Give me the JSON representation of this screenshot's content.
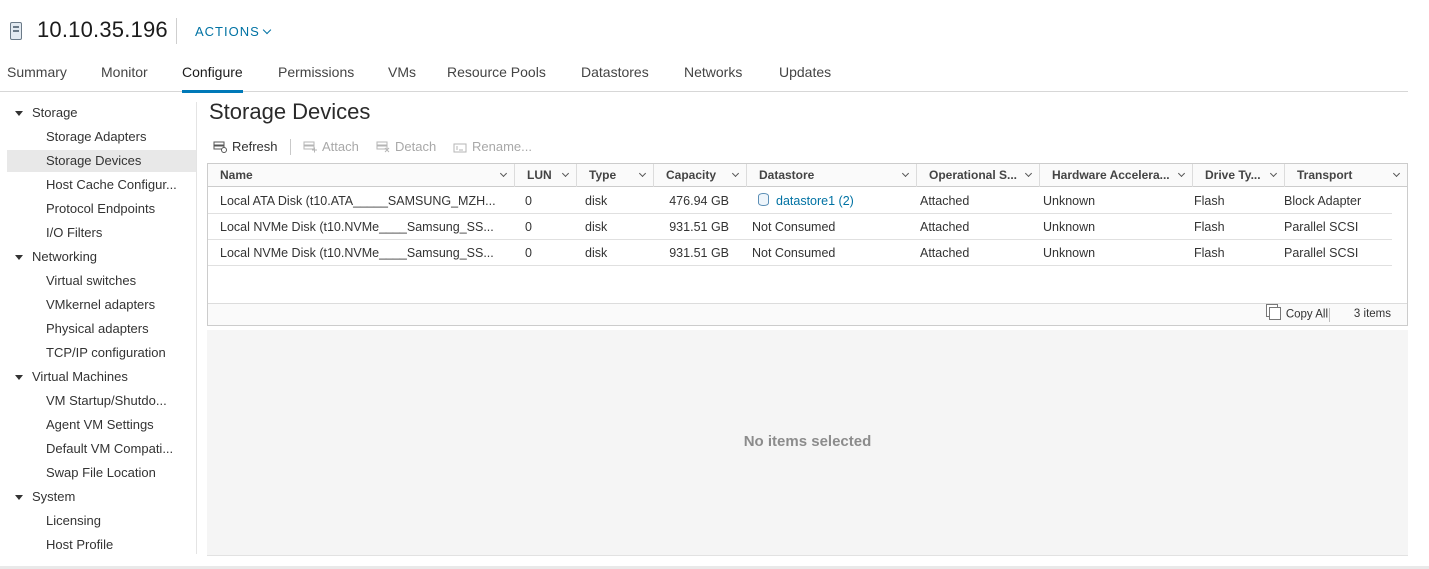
{
  "header": {
    "title": "10.10.35.196",
    "actions_label": "ACTIONS"
  },
  "tabs": [
    {
      "label": "Summary"
    },
    {
      "label": "Monitor"
    },
    {
      "label": "Configure",
      "active": true
    },
    {
      "label": "Permissions"
    },
    {
      "label": "VMs"
    },
    {
      "label": "Resource Pools"
    },
    {
      "label": "Datastores"
    },
    {
      "label": "Networks"
    },
    {
      "label": "Updates"
    }
  ],
  "sidebar": {
    "items": [
      {
        "label": "Storage",
        "kind": "group"
      },
      {
        "label": "Storage Adapters",
        "kind": "child"
      },
      {
        "label": "Storage Devices",
        "kind": "child",
        "selected": true
      },
      {
        "label": "Host Cache Configur...",
        "kind": "child"
      },
      {
        "label": "Protocol Endpoints",
        "kind": "child"
      },
      {
        "label": "I/O Filters",
        "kind": "child"
      },
      {
        "label": "Networking",
        "kind": "group"
      },
      {
        "label": "Virtual switches",
        "kind": "child"
      },
      {
        "label": "VMkernel adapters",
        "kind": "child"
      },
      {
        "label": "Physical adapters",
        "kind": "child"
      },
      {
        "label": "TCP/IP configuration",
        "kind": "child"
      },
      {
        "label": "Virtual Machines",
        "kind": "group"
      },
      {
        "label": "VM Startup/Shutdo...",
        "kind": "child"
      },
      {
        "label": "Agent VM Settings",
        "kind": "child"
      },
      {
        "label": "Default VM Compati...",
        "kind": "child"
      },
      {
        "label": "Swap File Location",
        "kind": "child"
      },
      {
        "label": "System",
        "kind": "group"
      },
      {
        "label": "Licensing",
        "kind": "child"
      },
      {
        "label": "Host Profile",
        "kind": "child"
      }
    ]
  },
  "main": {
    "title": "Storage Devices",
    "toolbar": {
      "refresh": "Refresh",
      "attach": "Attach",
      "detach": "Detach",
      "rename": "Rename..."
    },
    "table": {
      "columns": [
        "Name",
        "LUN",
        "Type",
        "Capacity",
        "Datastore",
        "Operational S...",
        "Hardware Accelera...",
        "Drive Ty...",
        "Transport"
      ],
      "rows": [
        [
          "Local ATA Disk (t10.ATA_____SAMSUNG_MZH...",
          "0",
          "disk",
          "476.94 GB",
          "datastore1 (2)",
          "Attached",
          "Unknown",
          "Flash",
          "Block Adapter"
        ],
        [
          "Local NVMe Disk (t10.NVMe____Samsung_SS...",
          "0",
          "disk",
          "931.51 GB",
          "Not Consumed",
          "Attached",
          "Unknown",
          "Flash",
          "Parallel SCSI"
        ],
        [
          "Local NVMe Disk (t10.NVMe____Samsung_SS...",
          "0",
          "disk",
          "931.51 GB",
          "Not Consumed",
          "Attached",
          "Unknown",
          "Flash",
          "Parallel SCSI"
        ]
      ],
      "footer": {
        "copy_all": "Copy All",
        "count": "3 items"
      }
    },
    "details": {
      "empty_message": "No items selected"
    }
  }
}
